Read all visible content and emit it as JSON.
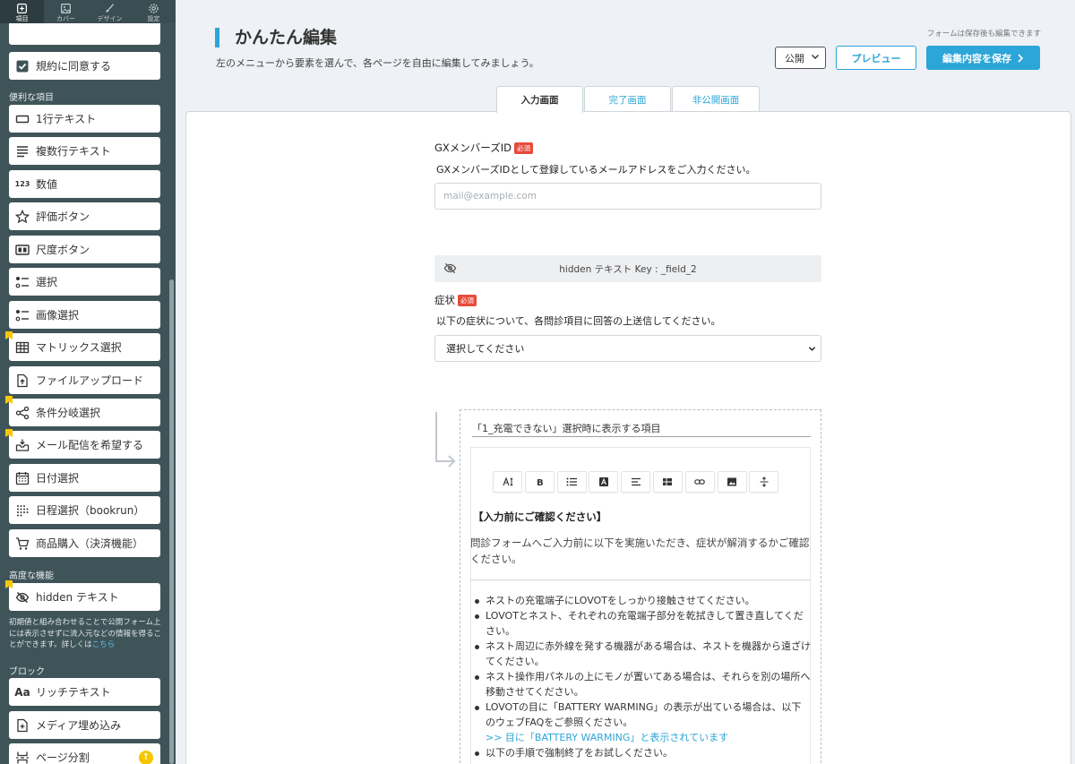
{
  "sidebar": {
    "nav_tabs": [
      {
        "label": "項目",
        "icon": "add-square-icon"
      },
      {
        "label": "カバー",
        "icon": "image-icon"
      },
      {
        "label": "デザイン",
        "icon": "brush-icon"
      },
      {
        "label": "設定",
        "icon": "gear-icon"
      }
    ],
    "top_items": [
      {
        "label": "規約に同意する",
        "icon": "checkbox-icon"
      }
    ],
    "section_basic": "便利な項目",
    "basic_items": [
      {
        "label": "1行テキスト",
        "icon": "single-line-icon"
      },
      {
        "label": "複数行テキスト",
        "icon": "multi-line-icon"
      },
      {
        "label": "数値",
        "icon": "number-icon"
      },
      {
        "label": "評価ボタン",
        "icon": "star-icon"
      },
      {
        "label": "尺度ボタン",
        "icon": "scale-icon"
      },
      {
        "label": "選択",
        "icon": "select-list-icon"
      },
      {
        "label": "画像選択",
        "icon": "image-select-icon"
      },
      {
        "label": "マトリックス選択",
        "icon": "matrix-icon"
      },
      {
        "label": "ファイルアップロード",
        "icon": "file-upload-icon"
      },
      {
        "label": "条件分岐選択",
        "icon": "branch-icon"
      },
      {
        "label": "メール配信を希望する",
        "icon": "mail-inbox-icon"
      },
      {
        "label": "日付選択",
        "icon": "calendar-icon"
      },
      {
        "label": "日程選択（bookrun）",
        "icon": "schedule-grid-icon"
      },
      {
        "label": "商品購入（決済機能）",
        "icon": "cart-icon"
      }
    ],
    "section_advanced": "高度な機能",
    "advanced_items": [
      {
        "label": "hidden テキスト",
        "icon": "eye-off-icon"
      }
    ],
    "advanced_note": "初期値と組み合わせることで公開フォーム上には表示させずに流入元などの情報を得ることができます。詳しくは",
    "advanced_note_link": "こちら",
    "section_block": "ブロック",
    "block_items": [
      {
        "label": "リッチテキスト",
        "icon": "rich-text-icon"
      },
      {
        "label": "メディア埋め込み",
        "icon": "media-embed-icon"
      },
      {
        "label": "ページ分割",
        "icon": "page-split-icon"
      }
    ]
  },
  "header": {
    "title": "かんたん編集",
    "subtitle": "左のメニューから要素を選んで、各ページを自由に編集してみましょう。",
    "save_note": "フォームは保存後も編集できます",
    "visibility_value": "公開",
    "preview_label": "プレビュー",
    "save_label": "編集内容を保存"
  },
  "page_tabs": [
    "入力画面",
    "完了画面",
    "非公開画面"
  ],
  "form": {
    "email_label": "GXメンバーズID",
    "required_badge": "必須",
    "email_desc": "GXメンバーズIDとして登録しているメールアドレスをご入力ください。",
    "email_placeholder": "mail@example.com",
    "hidden_text": "hidden テキスト Key : _field_2",
    "symptom_label": "症状",
    "symptom_desc": "以下の症状について、各問診項目に回答の上送信してください。",
    "symptom_select_value": "選択してください"
  },
  "conditional": {
    "title": "「1_充電できない」選択時に表示する項目",
    "toolbar_icons": [
      "font-size-icon",
      "bold-icon",
      "list-icon",
      "text-color-icon",
      "align-icon",
      "table-icon",
      "link-icon",
      "image-icon",
      "strikethrough-icon"
    ],
    "heading": "【入力前にご確認ください】",
    "intro": "問診フォームへご入力前に以下を実施いただき、症状が解消するかご確認ください。",
    "list": [
      {
        "text": "ネストの充電端子にLOVOTをしっかり接触させてください。",
        "link": false
      },
      {
        "text": "LOVOTとネスト、それぞれの充電端子部分を乾拭きして置き直してください。",
        "link": false
      },
      {
        "text": "ネスト周辺に赤外線を発する機器がある場合は、ネストを機器から遠ざけてください。",
        "link": false
      },
      {
        "text": "ネスト操作用パネルの上にモノが置いてある場合は、それらを別の場所へ移動させてください。",
        "link": false
      },
      {
        "text": "LOVOTの目に「BATTERY WARMING」の表示が出ている場合は、以下のウェブFAQをご参照ください。",
        "link": false
      },
      {
        "text": ">> 目に「BATTERY WARMING」と表示されています",
        "link": true
      },
      {
        "text": "以下の手順で強制終了をお試しください。",
        "link": false
      }
    ]
  },
  "colors": {
    "sidebar_bg": "#3f5459",
    "accent": "#2ca5d8",
    "required": "#e64b3c",
    "flag": "#f5c900"
  }
}
